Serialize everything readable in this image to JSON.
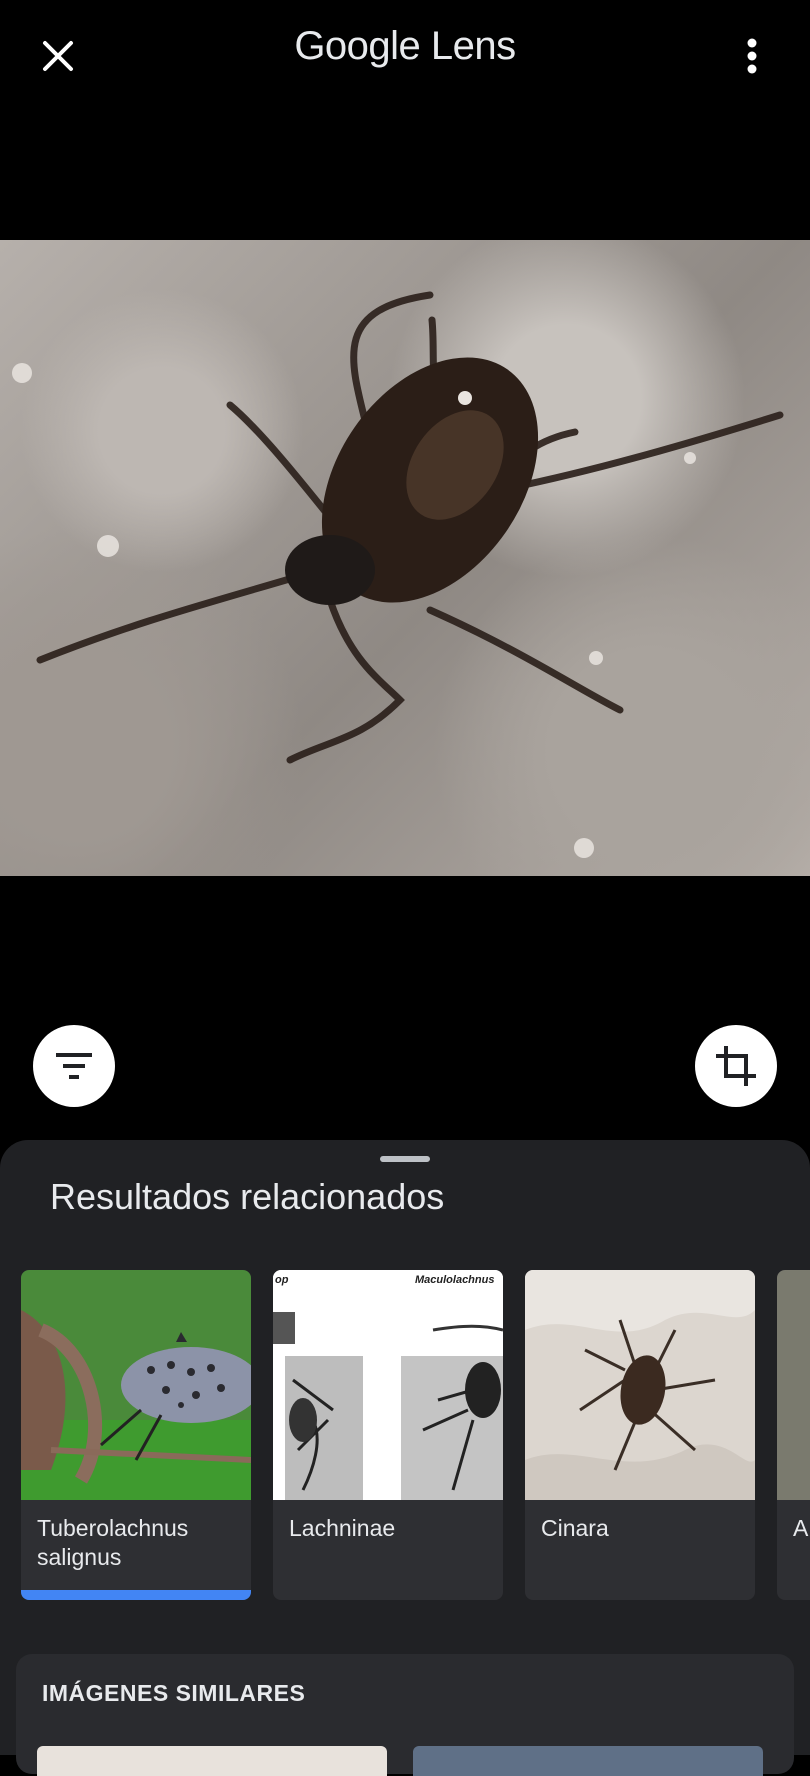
{
  "header": {
    "title_google": "Google",
    "title_lens": "Lens",
    "close_icon": "close-icon",
    "menu_icon": "more-vert-icon"
  },
  "image": {
    "subject": "small dark insect on speckled stone"
  },
  "buttons": {
    "filter_icon": "filter-icon",
    "crop_icon": "crop-icon"
  },
  "sheet": {
    "title": "Resultados relacionados",
    "results": [
      {
        "label": "Tuberolachnus salignus",
        "selected": true
      },
      {
        "label": "Lachninae",
        "caption": "Maculolachnus",
        "extra": "op"
      },
      {
        "label": "Cinara"
      },
      {
        "label": "A"
      }
    ],
    "similar_title": "IMÁGENES SIMILARES"
  },
  "colors": {
    "sheet_bg": "#202124",
    "accent": "#4285f4"
  }
}
